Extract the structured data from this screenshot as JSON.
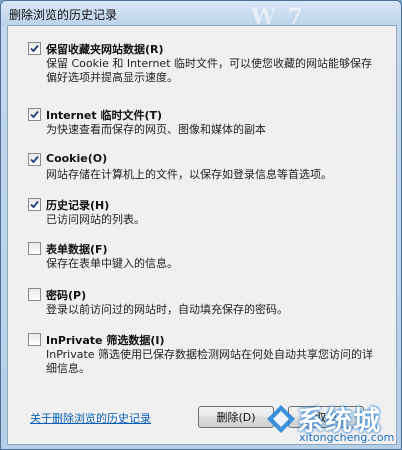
{
  "window": {
    "title": "删除浏览的历史记录",
    "title_watermark": "W 7"
  },
  "options": [
    {
      "label": "保留收藏夹网站数据(R)",
      "description": "保留 Cookie 和 Internet 临时文件，可以使您收藏的网站能够保存偏好选项并提高显示速度。",
      "checked": true
    },
    {
      "label": "Internet 临时文件(T)",
      "description": "为快速查看而保存的网页、图像和媒体的副本",
      "checked": true
    },
    {
      "label": "Cookie(O)",
      "description": "网站存储在计算机上的文件，以保存如登录信息等首选项。",
      "checked": true
    },
    {
      "label": "历史记录(H)",
      "description": "已访问网站的列表。",
      "checked": true
    },
    {
      "label": "表单数据(F)",
      "description": "保存在表单中键入的信息。",
      "checked": false
    },
    {
      "label": "密码(P)",
      "description": "登录以前访问过的网站时，自动填充保存的密码。",
      "checked": false
    },
    {
      "label": "InPrivate 筛选数据(I)",
      "description": "InPrivate 筛选使用已保存数据检测网站在何处自动共享您访问的详细信息。",
      "checked": false
    }
  ],
  "footer": {
    "link": "关于删除浏览的历史记录",
    "delete_button": "删除(D)",
    "cancel_button": "取消"
  },
  "watermark": {
    "brand": "系统城",
    "url": "xitongcheng.com"
  },
  "colors": {
    "accent": "#0a5fb4",
    "window_frame": "#b5cfe8",
    "client_bg": "#f0f0f0"
  }
}
